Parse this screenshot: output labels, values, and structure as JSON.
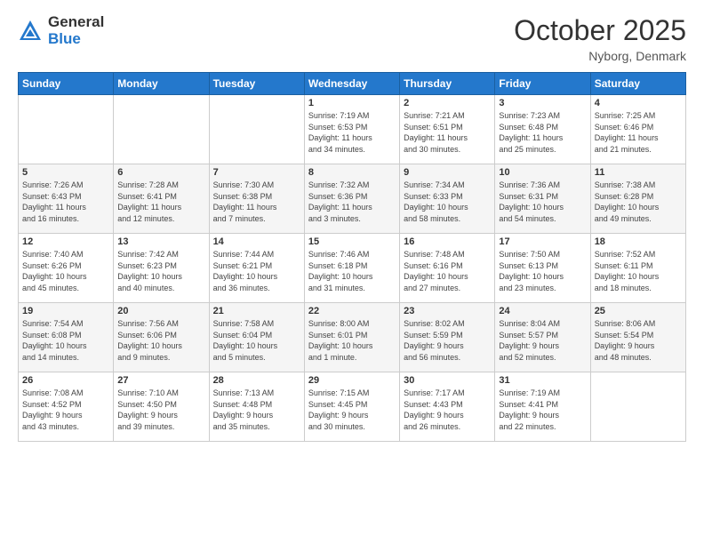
{
  "logo": {
    "general": "General",
    "blue": "Blue"
  },
  "header": {
    "month": "October 2025",
    "location": "Nyborg, Denmark"
  },
  "days_of_week": [
    "Sunday",
    "Monday",
    "Tuesday",
    "Wednesday",
    "Thursday",
    "Friday",
    "Saturday"
  ],
  "weeks": [
    [
      {
        "day": "",
        "info": ""
      },
      {
        "day": "",
        "info": ""
      },
      {
        "day": "",
        "info": ""
      },
      {
        "day": "1",
        "info": "Sunrise: 7:19 AM\nSunset: 6:53 PM\nDaylight: 11 hours\nand 34 minutes."
      },
      {
        "day": "2",
        "info": "Sunrise: 7:21 AM\nSunset: 6:51 PM\nDaylight: 11 hours\nand 30 minutes."
      },
      {
        "day": "3",
        "info": "Sunrise: 7:23 AM\nSunset: 6:48 PM\nDaylight: 11 hours\nand 25 minutes."
      },
      {
        "day": "4",
        "info": "Sunrise: 7:25 AM\nSunset: 6:46 PM\nDaylight: 11 hours\nand 21 minutes."
      }
    ],
    [
      {
        "day": "5",
        "info": "Sunrise: 7:26 AM\nSunset: 6:43 PM\nDaylight: 11 hours\nand 16 minutes."
      },
      {
        "day": "6",
        "info": "Sunrise: 7:28 AM\nSunset: 6:41 PM\nDaylight: 11 hours\nand 12 minutes."
      },
      {
        "day": "7",
        "info": "Sunrise: 7:30 AM\nSunset: 6:38 PM\nDaylight: 11 hours\nand 7 minutes."
      },
      {
        "day": "8",
        "info": "Sunrise: 7:32 AM\nSunset: 6:36 PM\nDaylight: 11 hours\nand 3 minutes."
      },
      {
        "day": "9",
        "info": "Sunrise: 7:34 AM\nSunset: 6:33 PM\nDaylight: 10 hours\nand 58 minutes."
      },
      {
        "day": "10",
        "info": "Sunrise: 7:36 AM\nSunset: 6:31 PM\nDaylight: 10 hours\nand 54 minutes."
      },
      {
        "day": "11",
        "info": "Sunrise: 7:38 AM\nSunset: 6:28 PM\nDaylight: 10 hours\nand 49 minutes."
      }
    ],
    [
      {
        "day": "12",
        "info": "Sunrise: 7:40 AM\nSunset: 6:26 PM\nDaylight: 10 hours\nand 45 minutes."
      },
      {
        "day": "13",
        "info": "Sunrise: 7:42 AM\nSunset: 6:23 PM\nDaylight: 10 hours\nand 40 minutes."
      },
      {
        "day": "14",
        "info": "Sunrise: 7:44 AM\nSunset: 6:21 PM\nDaylight: 10 hours\nand 36 minutes."
      },
      {
        "day": "15",
        "info": "Sunrise: 7:46 AM\nSunset: 6:18 PM\nDaylight: 10 hours\nand 31 minutes."
      },
      {
        "day": "16",
        "info": "Sunrise: 7:48 AM\nSunset: 6:16 PM\nDaylight: 10 hours\nand 27 minutes."
      },
      {
        "day": "17",
        "info": "Sunrise: 7:50 AM\nSunset: 6:13 PM\nDaylight: 10 hours\nand 23 minutes."
      },
      {
        "day": "18",
        "info": "Sunrise: 7:52 AM\nSunset: 6:11 PM\nDaylight: 10 hours\nand 18 minutes."
      }
    ],
    [
      {
        "day": "19",
        "info": "Sunrise: 7:54 AM\nSunset: 6:08 PM\nDaylight: 10 hours\nand 14 minutes."
      },
      {
        "day": "20",
        "info": "Sunrise: 7:56 AM\nSunset: 6:06 PM\nDaylight: 10 hours\nand 9 minutes."
      },
      {
        "day": "21",
        "info": "Sunrise: 7:58 AM\nSunset: 6:04 PM\nDaylight: 10 hours\nand 5 minutes."
      },
      {
        "day": "22",
        "info": "Sunrise: 8:00 AM\nSunset: 6:01 PM\nDaylight: 10 hours\nand 1 minute."
      },
      {
        "day": "23",
        "info": "Sunrise: 8:02 AM\nSunset: 5:59 PM\nDaylight: 9 hours\nand 56 minutes."
      },
      {
        "day": "24",
        "info": "Sunrise: 8:04 AM\nSunset: 5:57 PM\nDaylight: 9 hours\nand 52 minutes."
      },
      {
        "day": "25",
        "info": "Sunrise: 8:06 AM\nSunset: 5:54 PM\nDaylight: 9 hours\nand 48 minutes."
      }
    ],
    [
      {
        "day": "26",
        "info": "Sunrise: 7:08 AM\nSunset: 4:52 PM\nDaylight: 9 hours\nand 43 minutes."
      },
      {
        "day": "27",
        "info": "Sunrise: 7:10 AM\nSunset: 4:50 PM\nDaylight: 9 hours\nand 39 minutes."
      },
      {
        "day": "28",
        "info": "Sunrise: 7:13 AM\nSunset: 4:48 PM\nDaylight: 9 hours\nand 35 minutes."
      },
      {
        "day": "29",
        "info": "Sunrise: 7:15 AM\nSunset: 4:45 PM\nDaylight: 9 hours\nand 30 minutes."
      },
      {
        "day": "30",
        "info": "Sunrise: 7:17 AM\nSunset: 4:43 PM\nDaylight: 9 hours\nand 26 minutes."
      },
      {
        "day": "31",
        "info": "Sunrise: 7:19 AM\nSunset: 4:41 PM\nDaylight: 9 hours\nand 22 minutes."
      },
      {
        "day": "",
        "info": ""
      }
    ]
  ]
}
